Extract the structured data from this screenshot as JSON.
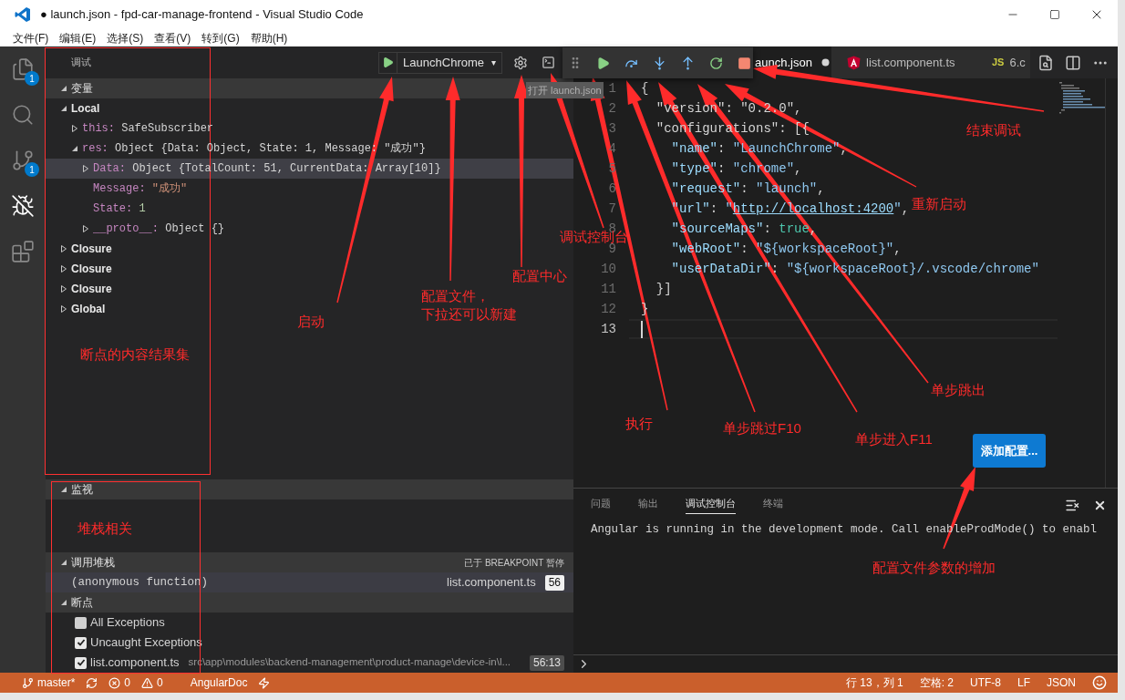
{
  "window": {
    "title": "● launch.json - fpd-car-manage-frontend - Visual Studio Code"
  },
  "menu": [
    "文件(F)",
    "编辑(E)",
    "选择(S)",
    "查看(V)",
    "转到(G)",
    "帮助(H)"
  ],
  "activity_bar": [
    {
      "kind": "files",
      "badge": "1",
      "selected": false
    },
    {
      "kind": "search",
      "selected": false
    },
    {
      "kind": "git",
      "badge": "1",
      "selected": false
    },
    {
      "kind": "debug",
      "selected": true
    },
    {
      "kind": "extensions",
      "selected": false
    }
  ],
  "debug_header": {
    "title": "调试",
    "configuration": "LaunchChrome",
    "caret": "▾"
  },
  "variables": {
    "title": "变量",
    "expanded": true,
    "scopes": [
      {
        "kind": "scope",
        "name": "Local",
        "expanded": true,
        "selected": false,
        "children": [
          {
            "kind": "object",
            "name": "this:",
            "value": "SafeSubscriber",
            "expanded": false,
            "selected": false
          },
          {
            "kind": "object",
            "name": "res:",
            "value": "Object {Data: Object, State: 1, Message: \"成功\"}",
            "expanded": true,
            "selected": false,
            "children": [
              {
                "kind": "object",
                "name": "Data:",
                "value": "Object {TotalCount: 51, CurrentData: Array[10]}",
                "expanded": false,
                "selected": true
              },
              {
                "kind": "string",
                "name": "Message:",
                "value": "\"成功\"",
                "selected": false
              },
              {
                "kind": "number",
                "name": "State:",
                "value": "1",
                "selected": false
              },
              {
                "kind": "object",
                "name": "__proto__:",
                "value": "Object {}",
                "expanded": false,
                "selected": false
              }
            ]
          }
        ]
      },
      {
        "kind": "scope",
        "name": "Closure",
        "expanded": false,
        "selected": false
      },
      {
        "kind": "scope",
        "name": "Closure",
        "expanded": false,
        "selected": false
      },
      {
        "kind": "scope",
        "name": "Closure",
        "expanded": false,
        "selected": false
      },
      {
        "kind": "scope",
        "name": "Global",
        "expanded": false,
        "selected": false
      }
    ]
  },
  "watch": {
    "title": "监视",
    "expanded": true
  },
  "call_stack": {
    "title": "调用堆栈",
    "expanded": true,
    "status": "已于 BREAKPOINT 暂停",
    "frames": [
      {
        "name": "(anonymous function)",
        "file": "list.component.ts",
        "line": "56",
        "selected": true
      }
    ]
  },
  "breakpoints": {
    "title": "断点",
    "expanded": true,
    "items": [
      {
        "label": "All Exceptions",
        "checked": false
      },
      {
        "label": "Uncaught Exceptions",
        "checked": true
      },
      {
        "label": "list.component.ts",
        "path": "src\\app\\modules\\backend-management\\product-manage\\device-in\\l...",
        "position": "56:13",
        "checked": true
      }
    ]
  },
  "debug_toolbar": [
    {
      "kind": "grip"
    },
    {
      "kind": "continue"
    },
    {
      "kind": "step-over"
    },
    {
      "kind": "step-into"
    },
    {
      "kind": "step-out"
    },
    {
      "kind": "restart"
    },
    {
      "kind": "stop"
    }
  ],
  "tooltip": "打开 launch.json",
  "tabs": [
    {
      "label": "aunch.json",
      "kind": "json",
      "dirty": true,
      "selected": true
    },
    {
      "label": "list.component.ts",
      "kind": "angular",
      "dirty": false,
      "selected": false
    },
    {
      "label": "6.c",
      "kind": "js",
      "icon_text": "JS",
      "dirty": false,
      "selected": false
    }
  ],
  "editor": {
    "lines": [
      {
        "number": "1",
        "current": false,
        "tokens": [
          {
            "text": "{",
            "kind": "plain"
          }
        ]
      },
      {
        "number": "2",
        "current": false,
        "tokens": [
          {
            "text": "  \"version\": \"0.2.0\",",
            "kind": "plain"
          }
        ]
      },
      {
        "number": "3",
        "current": false,
        "tokens": [
          {
            "text": "  \"configurations\": [{",
            "kind": "plain"
          }
        ]
      },
      {
        "number": "4",
        "current": false,
        "tokens": [
          {
            "text": "    \"name\"",
            "kind": "key"
          },
          {
            "text": ": ",
            "kind": "plain"
          },
          {
            "text": "\"LaunchChrome\"",
            "kind": "string"
          },
          {
            "text": ",",
            "kind": "plain"
          }
        ]
      },
      {
        "number": "5",
        "current": false,
        "tokens": [
          {
            "text": "    \"type\"",
            "kind": "key"
          },
          {
            "text": ": ",
            "kind": "plain"
          },
          {
            "text": "\"chrome\"",
            "kind": "string"
          },
          {
            "text": ",",
            "kind": "plain"
          }
        ]
      },
      {
        "number": "6",
        "current": false,
        "tokens": [
          {
            "text": "    \"request\"",
            "kind": "key"
          },
          {
            "text": ": ",
            "kind": "plain"
          },
          {
            "text": "\"launch\"",
            "kind": "string"
          },
          {
            "text": ",",
            "kind": "plain"
          }
        ]
      },
      {
        "number": "7",
        "current": false,
        "tokens": [
          {
            "text": "    \"url\"",
            "kind": "key"
          },
          {
            "text": ": ",
            "kind": "plain"
          },
          {
            "text": "\"",
            "kind": "string"
          },
          {
            "text": "http://localhost:4200",
            "kind": "link"
          },
          {
            "text": "\"",
            "kind": "string"
          },
          {
            "text": ",",
            "kind": "plain"
          }
        ]
      },
      {
        "number": "8",
        "current": false,
        "tokens": [
          {
            "text": "    \"sourceMaps\"",
            "kind": "key"
          },
          {
            "text": ": ",
            "kind": "plain"
          },
          {
            "text": "true",
            "kind": "bool"
          },
          {
            "text": ",",
            "kind": "plain"
          }
        ]
      },
      {
        "number": "9",
        "current": false,
        "tokens": [
          {
            "text": "    \"webRoot\"",
            "kind": "key"
          },
          {
            "text": ": ",
            "kind": "plain"
          },
          {
            "text": "\"${workspaceRoot}\"",
            "kind": "string"
          },
          {
            "text": ",",
            "kind": "plain"
          }
        ]
      },
      {
        "number": "10",
        "current": false,
        "tokens": [
          {
            "text": "    \"userDataDir\"",
            "kind": "key"
          },
          {
            "text": ": ",
            "kind": "plain"
          },
          {
            "text": "\"${workspaceRoot}/.vscode/chrome\"",
            "kind": "string"
          }
        ]
      },
      {
        "number": "11",
        "current": false,
        "tokens": [
          {
            "text": "  }]",
            "kind": "plain"
          }
        ]
      },
      {
        "number": "12",
        "current": false,
        "tokens": [
          {
            "text": "}",
            "kind": "plain"
          }
        ]
      },
      {
        "number": "13",
        "current": true
      }
    ]
  },
  "add_config_button": "添加配置...",
  "panel": {
    "tabs": [
      {
        "label": "问题",
        "selected": false
      },
      {
        "label": "输出",
        "selected": false
      },
      {
        "label": "调试控制台",
        "selected": true
      },
      {
        "label": "终端",
        "selected": false
      }
    ],
    "output": [
      "Angular is running in the development mode. Call enableProdMode() to enabl"
    ]
  },
  "status_bar": {
    "left": [
      {
        "kind": "branch",
        "text": "master*"
      },
      {
        "kind": "sync"
      },
      {
        "kind": "errors",
        "text": "0"
      },
      {
        "kind": "warnings",
        "text": "0"
      },
      {
        "kind": "text",
        "text": "AngularDoc"
      },
      {
        "kind": "bolt"
      }
    ],
    "right": [
      {
        "kind": "text",
        "text": "行 13，列 1"
      },
      {
        "kind": "text",
        "text": "空格: 2"
      },
      {
        "kind": "text",
        "text": "UTF-8"
      },
      {
        "kind": "text",
        "text": "LF"
      },
      {
        "kind": "text",
        "text": "JSON"
      },
      {
        "kind": "smiley"
      }
    ]
  },
  "annotations": [
    {
      "lines": [
        "结束调试"
      ]
    },
    {
      "lines": [
        "重新启动"
      ]
    },
    {
      "lines": [
        "调试控制台"
      ]
    },
    {
      "lines": [
        "配置中心"
      ]
    },
    {
      "lines": [
        "配置文件，",
        "下拉还可以新建"
      ]
    },
    {
      "lines": [
        "启动"
      ]
    },
    {
      "lines": [
        "断点的内容结果集"
      ]
    },
    {
      "lines": [
        "堆栈相关"
      ]
    },
    {
      "lines": [
        "单步跳出"
      ]
    },
    {
      "lines": [
        "执行"
      ]
    },
    {
      "lines": [
        "单步跳过F10"
      ]
    },
    {
      "lines": [
        "单步进入F11"
      ]
    },
    {
      "lines": [
        "配置文件参数的增加"
      ]
    }
  ]
}
